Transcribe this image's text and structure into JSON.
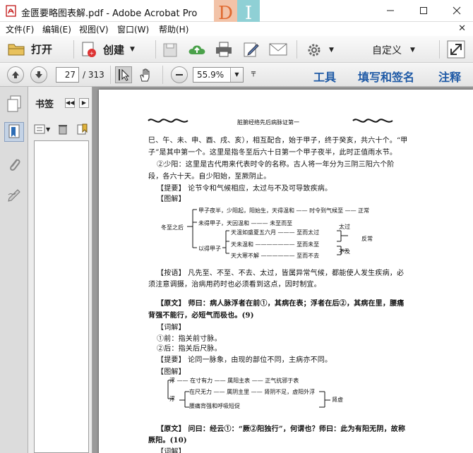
{
  "window": {
    "title": "金匮要略图表解.pdf - Adobe Acrobat Pro",
    "brand_left": "D",
    "brand_right": "I"
  },
  "menu": [
    "文件(F)",
    "编辑(E)",
    "视图(V)",
    "窗口(W)",
    "帮助(H)"
  ],
  "toolbar": {
    "open_label": "打开",
    "create_label": "创建",
    "customize_label": "自定义"
  },
  "nav": {
    "current_page": "27",
    "total_pages": "/ 313",
    "zoom": "55.9%",
    "tools_link": "工具",
    "fill_sign_link": "填写和签名",
    "comment_link": "注释"
  },
  "bookmarks": {
    "title": "书签"
  },
  "document": {
    "running_header": "脏腑经络先后病脉证第一",
    "lines": [
      "巳、午、未、申、酉、戌、亥），相互配合，始于甲子，终于癸亥，共六十个。“甲",
      "子”是其中第一个。这里是指冬至后六十日第一个甲子夜半，此时正值雨水节。",
      "②少阳：这里是古代用来代表时令的名称。古人将一年分为三阴三阳六个阶",
      "段，各六十天。自少阳始，至厥阴止。",
      "【提要】 论节令和气候相应，太过与不及可导致疾病。",
      "【图解】"
    ],
    "diagram1": {
      "root": "冬至之后",
      "b1": "甲子夜半，少阳起，阳始生，天得温和 —— 时令到气候至 —— 正常",
      "b2": "未得甲子，天因温和 ——— 未至而至",
      "b3": "以得甲子",
      "b3a": "天温如盛夏五六月 ——— 至而太过",
      "b3b": "天未温和 ——————— 至而未至",
      "b3c": "天大寒不解 —————— 至而不去",
      "r1": "太过",
      "r2": "不及",
      "r3": "反常"
    },
    "lines2": [
      "【按语】 凡先至、不至、不去、太过，皆属异常气候，都能使人发生疾病，必",
      "须注意调摄，治病用药时也必须看到这点，因时制宜。",
      "【原文】 师曰：病人脉浮者在前①，其病在表；浮者在后②，其病在里，腰痛",
      "背强不能行，必短气而极也。(9)",
      "【词解】",
      "①前：指关前寸脉。",
      "②后：指关后尺脉。",
      "【提要】 论同一脉象，由现的部位不同，主病亦不同。",
      "【图解】"
    ],
    "diagram2": {
      "root": "浮",
      "a1": "浮 —— 在寸有力 —— 属阳主表 —— 正气抗邪于表",
      "a2": "浮",
      "a2a": "在尺无力 —— 属阴主里 —— 肾阴不足，虚阳外浮",
      "a2b": "腰痛背强和呼吸短促",
      "end": "肾虚"
    },
    "lines3": [
      "【原文】 问曰：经云①：“厥②阳独行”，何谓也？师曰：此为有阳无阴，故称",
      "厥阳。(10)",
      "【词解】"
    ]
  },
  "colors": {
    "link_blue": "#1f5aa6",
    "pdf_red": "#c81e1e"
  }
}
